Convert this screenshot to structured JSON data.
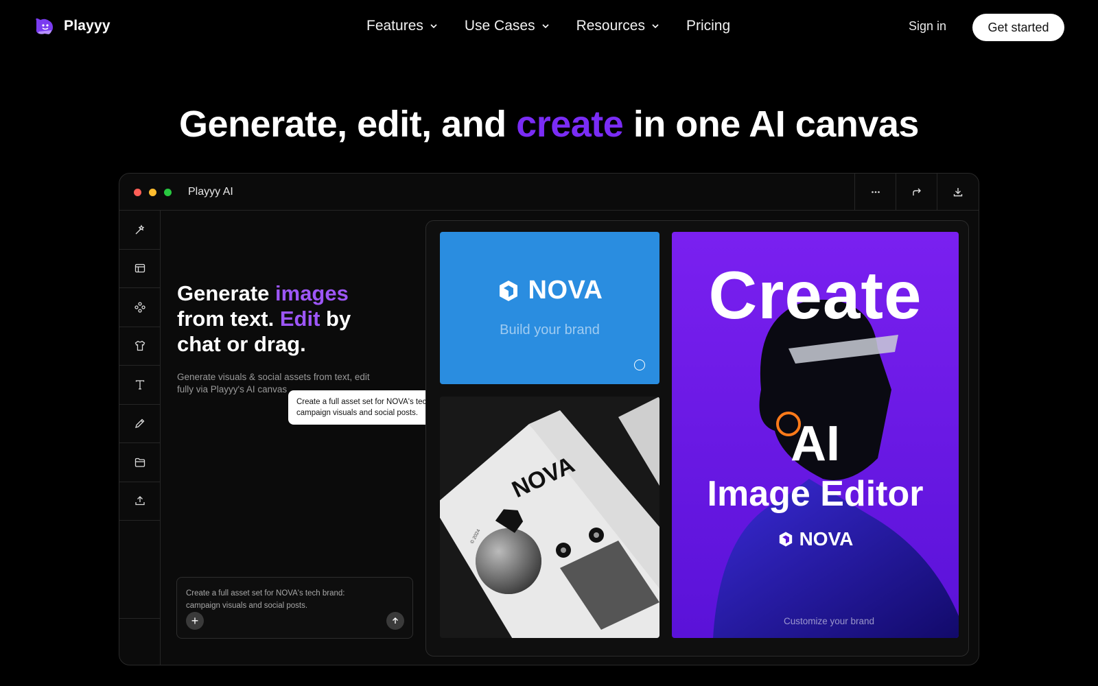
{
  "brand": {
    "name": "Playyy"
  },
  "nav": {
    "items": [
      {
        "label": "Features"
      },
      {
        "label": "Use Cases"
      },
      {
        "label": "Resources"
      },
      {
        "label": "Pricing"
      }
    ],
    "signin": "Sign in",
    "cta": "Get started"
  },
  "hero": {
    "part1": "Generate, edit, and ",
    "accent": "create",
    "part2": " in one AI canvas",
    "accent_color": "#7a2cf5"
  },
  "app": {
    "title": "Playyy AI",
    "toolbar_icons": [
      "magic-wand-icon",
      "layout-icon",
      "components-icon",
      "shirt-icon",
      "text-icon",
      "pencil-icon",
      "folder-icon",
      "upload-icon"
    ],
    "header_icons": [
      "more-icon",
      "share-icon",
      "download-icon"
    ],
    "left": {
      "t1": "Generate ",
      "t1a": "images",
      "t2": "from text. ",
      "t2a": "Edit",
      "t2b": " by",
      "t3": "chat or drag.",
      "subtitle": "Generate visuals & social assets from text, edit fully via Playyy's AI canvas",
      "bubble": "Create a full asset set for NOVA's tech brand: campaign visuals and social posts.",
      "composer": "Create a full asset set for NOVA's tech brand: campaign visuals and social posts."
    },
    "canvas": {
      "blue_card": {
        "brand": "NOVA",
        "tagline": "Build your brand"
      },
      "print_card": {
        "brand": "NOVA",
        "date": "© 2024"
      },
      "purple_card": {
        "headline": "Create",
        "ai": "AI",
        "editor": "Image Editor",
        "brand": "NOVA",
        "caption": "Customize your brand"
      }
    }
  },
  "colors": {
    "accent_purple": "#9d56f7",
    "blue_card": "#2a8de0",
    "purple_card": "#6a18e8"
  }
}
